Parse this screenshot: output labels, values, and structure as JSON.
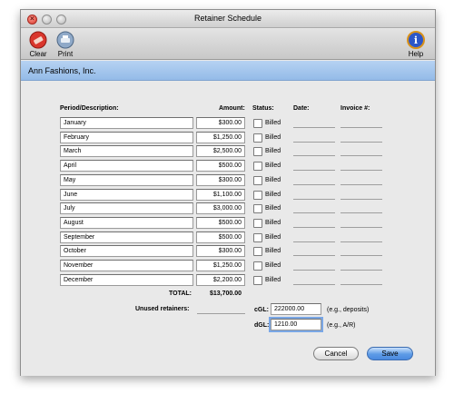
{
  "window": {
    "title": "Retainer Schedule"
  },
  "toolbar": {
    "clear_label": "Clear",
    "print_label": "Print",
    "help_label": "Help"
  },
  "header": {
    "company": "Ann Fashions, Inc."
  },
  "columns": {
    "period": "Period/Description:",
    "amount": "Amount:",
    "status": "Status:",
    "date": "Date:",
    "invoice": "Invoice #:"
  },
  "rows": [
    {
      "period": "January",
      "amount": "$300.00",
      "status": "Billed"
    },
    {
      "period": "February",
      "amount": "$1,250.00",
      "status": "Billed"
    },
    {
      "period": "March",
      "amount": "$2,500.00",
      "status": "Billed"
    },
    {
      "period": "April",
      "amount": "$500.00",
      "status": "Billed"
    },
    {
      "period": "May",
      "amount": "$300.00",
      "status": "Billed"
    },
    {
      "period": "June",
      "amount": "$1,100.00",
      "status": "Billed"
    },
    {
      "period": "July",
      "amount": "$3,000.00",
      "status": "Billed"
    },
    {
      "period": "August",
      "amount": "$500.00",
      "status": "Billed"
    },
    {
      "period": "September",
      "amount": "$500.00",
      "status": "Billed"
    },
    {
      "period": "October",
      "amount": "$300.00",
      "status": "Billed"
    },
    {
      "period": "November",
      "amount": "$1,250.00",
      "status": "Billed"
    },
    {
      "period": "December",
      "amount": "$2,200.00",
      "status": "Billed"
    }
  ],
  "totals": {
    "label": "TOTAL:",
    "value": "$13,700.00"
  },
  "unused": {
    "label": "Unused retainers:"
  },
  "gl": {
    "cgl_label": "cGL:",
    "cgl_value": "222000.00",
    "cgl_hint": "(e.g., deposits)",
    "dgl_label": "dGL:",
    "dgl_value": "1210.00",
    "dgl_hint": "(e.g., A/R)"
  },
  "buttons": {
    "cancel": "Cancel",
    "save": "Save"
  }
}
